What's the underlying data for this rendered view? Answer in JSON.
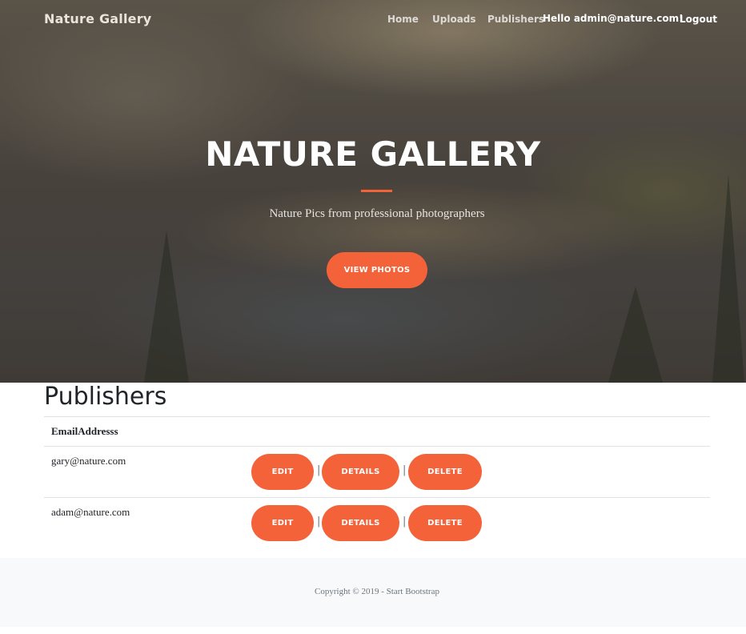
{
  "navbar": {
    "brand": "Nature Gallery",
    "links": [
      "Home",
      "Uploads",
      "Publishers"
    ],
    "greeting": "Hello admin@nature.com!",
    "logout": "Logout"
  },
  "hero": {
    "title": "NATURE GALLERY",
    "subtitle": "Nature Pics from professional photographers",
    "button": "VIEW PHOTOS"
  },
  "publishers": {
    "heading": "Publishers",
    "column": "EmailAddresss",
    "separator": "|",
    "rows": [
      {
        "email": "gary@nature.com",
        "edit": "EDIT",
        "details": "DETAILS",
        "delete": "DELETE"
      },
      {
        "email": "adam@nature.com",
        "edit": "EDIT",
        "details": "DETAILS",
        "delete": "DELETE"
      }
    ]
  },
  "footer": {
    "copyright": "Copyright © 2019 - Start Bootstrap"
  },
  "colors": {
    "accent": "#f4623a",
    "footer_bg": "#f8f9fa"
  }
}
